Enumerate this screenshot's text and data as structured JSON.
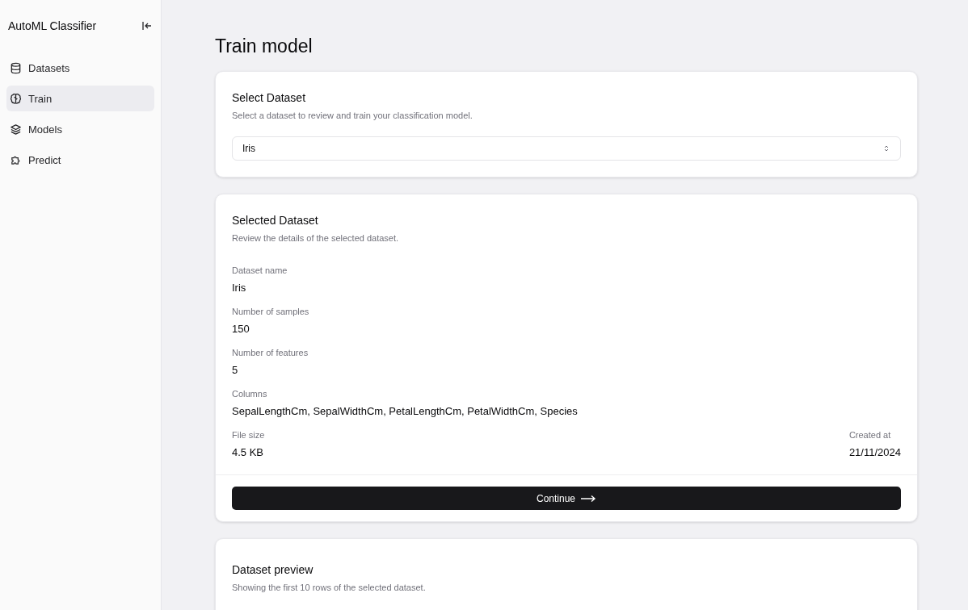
{
  "sidebar": {
    "title": "AutoML Classifier",
    "items": [
      {
        "label": "Datasets",
        "selected": false
      },
      {
        "label": "Train",
        "selected": true
      },
      {
        "label": "Models",
        "selected": false
      },
      {
        "label": "Predict",
        "selected": false
      }
    ]
  },
  "page_title": "Train model",
  "select_card": {
    "title": "Select Dataset",
    "description": "Select a dataset to review and train your classification model.",
    "select_value": "Iris"
  },
  "details_card": {
    "title": "Selected Dataset",
    "description": "Review the details of the selected dataset.",
    "fields": [
      {
        "label": "Dataset name",
        "value": "Iris"
      },
      {
        "label": "Number of samples",
        "value": "150"
      },
      {
        "label": "Number of features",
        "value": "5"
      },
      {
        "label": "Columns",
        "value": "SepalLengthCm, SepalWidthCm, PetalLengthCm, PetalWidthCm, Species"
      }
    ],
    "file_size": {
      "label": "File size",
      "value": "4.5 KB"
    },
    "created_at": {
      "label": "Created at",
      "value": "21/11/2024"
    },
    "button": "Continue"
  },
  "preview_card": {
    "title": "Dataset preview",
    "description": "Showing the first 10 rows of the selected dataset."
  }
}
